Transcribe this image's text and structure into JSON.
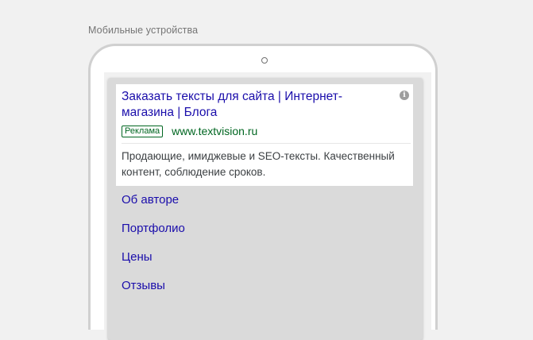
{
  "section": {
    "label": "Мобильные устройства"
  },
  "ad": {
    "title": "Заказать тексты для сайта | Интернет-магазина | Блога",
    "badge": "Реклама",
    "url": "www.textvision.ru",
    "description": "Продающие, имиджевые и SEO-тексты. Качественный контент, соблюдение сроков.",
    "info_icon": "info-icon"
  },
  "sitelinks": [
    {
      "label": "Об авторе"
    },
    {
      "label": "Портфолио"
    },
    {
      "label": "Цены"
    },
    {
      "label": "Отзывы"
    }
  ],
  "colors": {
    "link": "#1a0dab",
    "url_green": "#006621",
    "description": "#3c4043",
    "device_frame": "#d0d0d0",
    "page_bg": "#f1f1f1",
    "sitelinks_bg": "#dadada"
  }
}
